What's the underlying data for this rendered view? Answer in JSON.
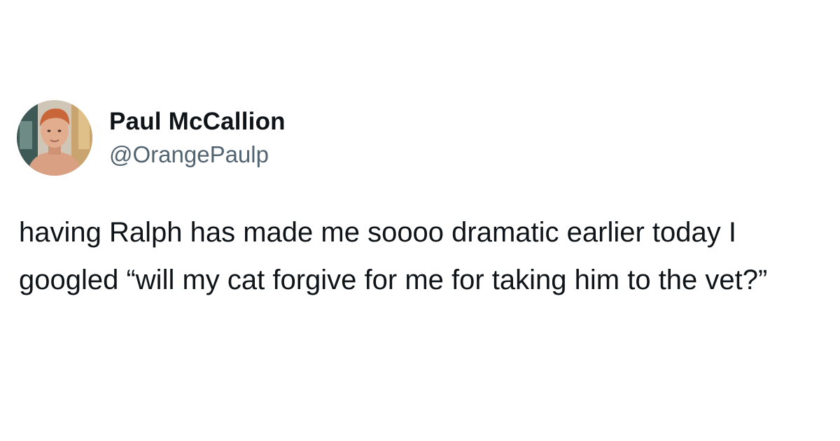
{
  "tweet": {
    "author": {
      "display_name": "Paul McCallion",
      "handle": "@OrangePaulp",
      "avatar_icon": "profile-photo"
    },
    "text": "having Ralph has made me soooo dramatic earlier today I googled “will my cat forgive for me for taking him to the vet?”"
  },
  "colors": {
    "background": "#ffffff",
    "primary_text": "#0f1419",
    "secondary_text": "#536471"
  }
}
